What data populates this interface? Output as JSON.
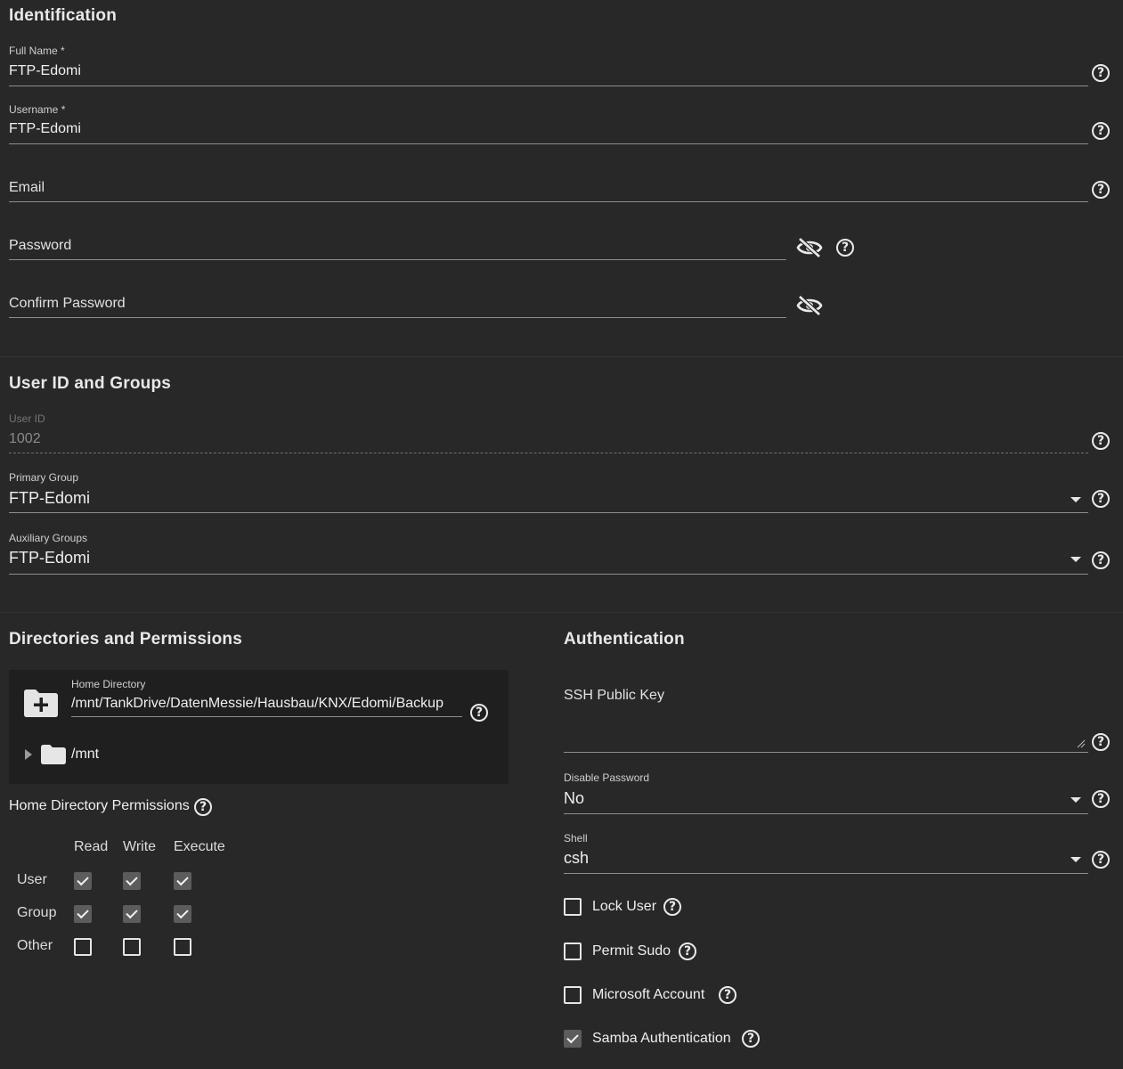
{
  "identification": {
    "title": "Identification",
    "full_name": {
      "label": "Full Name *",
      "value": "FTP-Edomi"
    },
    "username": {
      "label": "Username *",
      "value": "FTP-Edomi"
    },
    "email": {
      "placeholder": "Email"
    },
    "password": {
      "placeholder": "Password"
    },
    "confirm_password": {
      "placeholder": "Confirm Password"
    }
  },
  "user_id_groups": {
    "title": "User ID and Groups",
    "user_id": {
      "label": "User ID",
      "value": "1002"
    },
    "primary_group": {
      "label": "Primary Group",
      "value": "FTP-Edomi"
    },
    "auxiliary_groups": {
      "label": "Auxiliary Groups",
      "value": "FTP-Edomi"
    }
  },
  "directories": {
    "title": "Directories and Permissions",
    "home_directory": {
      "label": "Home Directory",
      "value": "/mnt/TankDrive/DatenMessie/Hausbau/KNX/Edomi/Backup"
    },
    "tree_root": "/mnt",
    "permissions_label": "Home Directory Permissions",
    "columns": [
      "Read",
      "Write",
      "Execute"
    ],
    "rows": [
      {
        "name": "User",
        "values": [
          true,
          true,
          true
        ]
      },
      {
        "name": "Group",
        "values": [
          true,
          true,
          true
        ]
      },
      {
        "name": "Other",
        "values": [
          false,
          false,
          false
        ]
      }
    ]
  },
  "authentication": {
    "title": "Authentication",
    "ssh_key": {
      "placeholder": "SSH Public Key"
    },
    "disable_password": {
      "label": "Disable Password",
      "value": "No"
    },
    "shell": {
      "label": "Shell",
      "value": "csh"
    },
    "checkboxes": [
      {
        "label": "Lock User",
        "checked": false
      },
      {
        "label": "Permit Sudo",
        "checked": false
      },
      {
        "label": "Microsoft Account",
        "checked": false
      },
      {
        "label": "Samba Authentication",
        "checked": true
      }
    ]
  },
  "help_glyph": "?",
  "colors": {
    "background": "#282828",
    "explorer": "#1f1f1f",
    "checked": "#5c5c5c"
  }
}
